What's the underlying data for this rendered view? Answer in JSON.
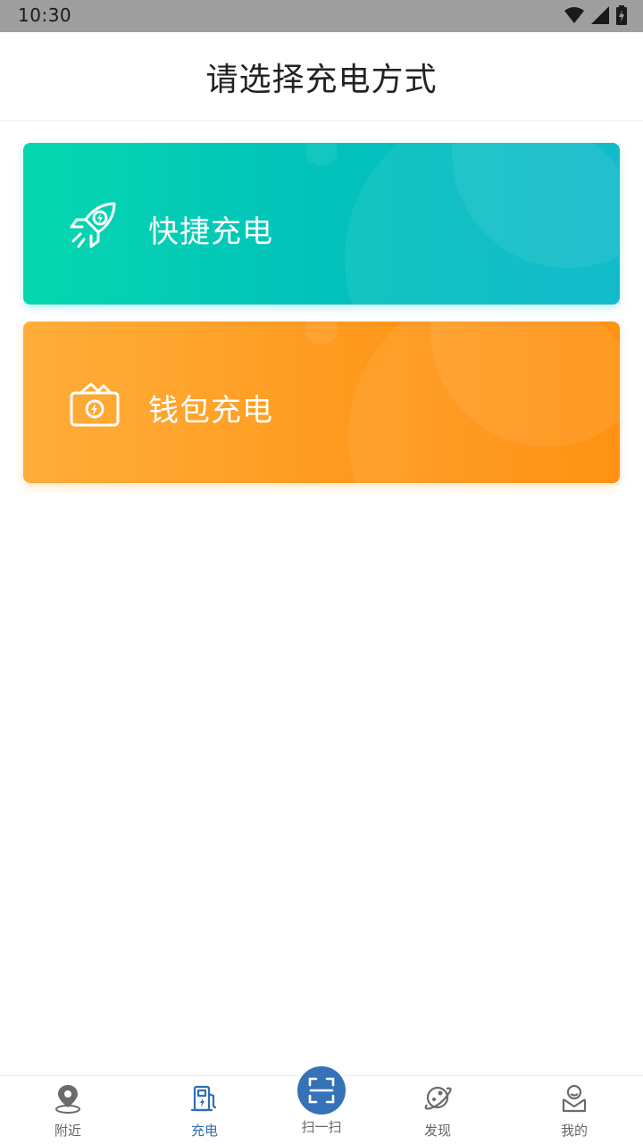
{
  "status_bar": {
    "time": "10:30"
  },
  "header": {
    "title": "请选择充电方式"
  },
  "options": [
    {
      "label": "快捷充电",
      "icon": "rocket-charge-icon",
      "color_start": "#05d7ae",
      "color_end": "#00b6c8"
    },
    {
      "label": "钱包充电",
      "icon": "wallet-charge-icon",
      "color_start": "#ffad3a",
      "color_end": "#ff8a00"
    }
  ],
  "tabbar": {
    "items": [
      {
        "label": "附近",
        "icon": "location-pin-icon"
      },
      {
        "label": "充电",
        "icon": "charging-station-icon",
        "active": true
      },
      {
        "label": "扫一扫",
        "icon": "scan-icon"
      },
      {
        "label": "发现",
        "icon": "planet-icon"
      },
      {
        "label": "我的",
        "icon": "user-profile-icon"
      }
    ],
    "active_color": "#2e6fb5"
  }
}
